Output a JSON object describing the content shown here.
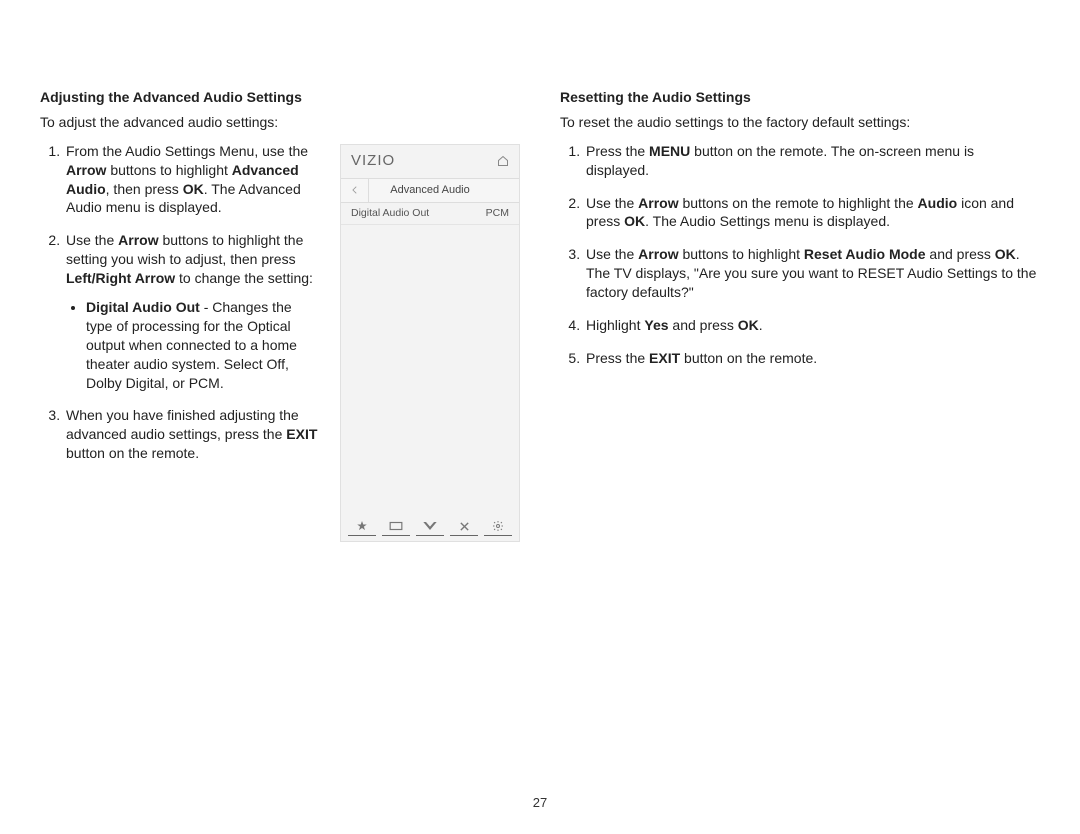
{
  "left": {
    "heading": "Adjusting the Advanced Audio Settings",
    "intro": "To adjust the advanced audio settings:",
    "step1_a": "From the Audio Settings Menu, use the ",
    "step1_b": "Arrow",
    "step1_c": " buttons to highlight ",
    "step1_d": "Advanced Audio",
    "step1_e": ", then press ",
    "step1_f": "OK",
    "step1_g": ". The Advanced Audio menu is displayed.",
    "step2_a": "Use the ",
    "step2_b": "Arrow",
    "step2_c": " buttons to highlight the setting you wish to adjust, then press ",
    "step2_d": "Left/Right Arrow",
    "step2_e": " to change the setting:",
    "bullet_a": "Digital Audio Out",
    "bullet_b": " - Changes the type of processing for the Optical output when connected to a home theater audio system. Select Off, Dolby Digital, or PCM.",
    "step3_a": "When you have finished adjusting the advanced audio settings, press the ",
    "step3_b": "EXIT",
    "step3_c": " button on the remote."
  },
  "tv": {
    "logo": "VIZIO",
    "title": "Advanced Audio",
    "row_label": "Digital Audio Out",
    "row_value": "PCM"
  },
  "right": {
    "heading": "Resetting the Audio Settings",
    "intro": "To reset the audio settings to the factory default settings:",
    "s1_a": "Press the ",
    "s1_b": "MENU",
    "s1_c": " button on the remote. The on-screen menu is displayed.",
    "s2_a": "Use the ",
    "s2_b": "Arrow",
    "s2_c": " buttons on the remote to highlight the ",
    "s2_d": "Audio",
    "s2_e": " icon and press ",
    "s2_f": "OK",
    "s2_g": ". The Audio Settings menu is displayed.",
    "s3_a": "Use the ",
    "s3_b": "Arrow",
    "s3_c": " buttons to highlight ",
    "s3_d": "Reset Audio Mode",
    "s3_e": " and press ",
    "s3_f": "OK",
    "s3_g": ". The TV displays, \"Are you sure you want to RESET Audio Settings to the factory defaults?\"",
    "s4_a": "Highlight ",
    "s4_b": "Yes",
    "s4_c": " and press ",
    "s4_d": "OK",
    "s4_e": ".",
    "s5_a": "Press the ",
    "s5_b": "EXIT",
    "s5_c": " button on the remote."
  },
  "page_number": "27"
}
